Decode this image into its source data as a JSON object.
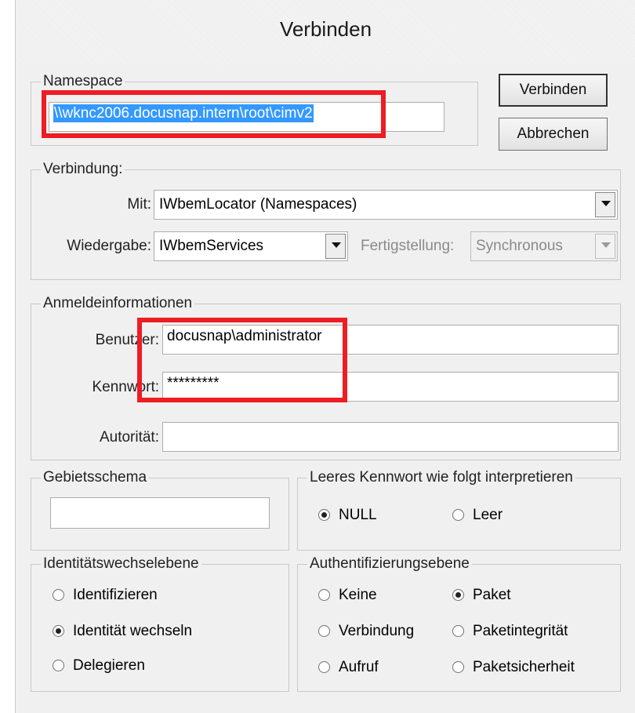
{
  "window": {
    "title": "Verbinden"
  },
  "namespace": {
    "legend": "Namespace",
    "value": "\\\\wknc2006.docusnap.intern\\root\\cimv2"
  },
  "buttons": {
    "connect": "Verbinden",
    "cancel": "Abbrechen"
  },
  "connection": {
    "legend": "Verbindung:",
    "with_label": "Mit:",
    "with_value": "IWbemLocator (Namespaces)",
    "playback_label": "Wiedergabe:",
    "playback_value": "IWbemServices",
    "completion_label": "Fertigstellung:",
    "completion_value": "Synchronous"
  },
  "credentials": {
    "legend": "Anmeldeinformationen",
    "user_label": "Benutzer:",
    "user_value": "docusnap\\administrator",
    "password_label": "Kennwort:",
    "password_value": "*********",
    "authority_label": "Autorität:",
    "authority_value": ""
  },
  "locale": {
    "legend": "Gebietsschema",
    "value": ""
  },
  "empty_password": {
    "legend": "Leeres Kennwort wie folgt interpretieren",
    "options": [
      {
        "label": "NULL",
        "selected": true
      },
      {
        "label": "Leer",
        "selected": false
      }
    ]
  },
  "impersonation": {
    "legend": "Identitätswechselebene",
    "options": [
      {
        "label": "Identifizieren",
        "selected": false
      },
      {
        "label": "Identität wechseln",
        "selected": true
      },
      {
        "label": "Delegieren",
        "selected": false
      }
    ]
  },
  "authentication": {
    "legend": "Authentifizierungsebene",
    "options": [
      {
        "label": "Keine",
        "selected": false
      },
      {
        "label": "Paket",
        "selected": true
      },
      {
        "label": "Verbindung",
        "selected": false
      },
      {
        "label": "Paketintegrität",
        "selected": false
      },
      {
        "label": "Aufruf",
        "selected": false
      },
      {
        "label": "Paketsicherheit",
        "selected": false
      }
    ]
  },
  "colors": {
    "highlight": "#ee1c24",
    "selection": "#3399ff"
  }
}
